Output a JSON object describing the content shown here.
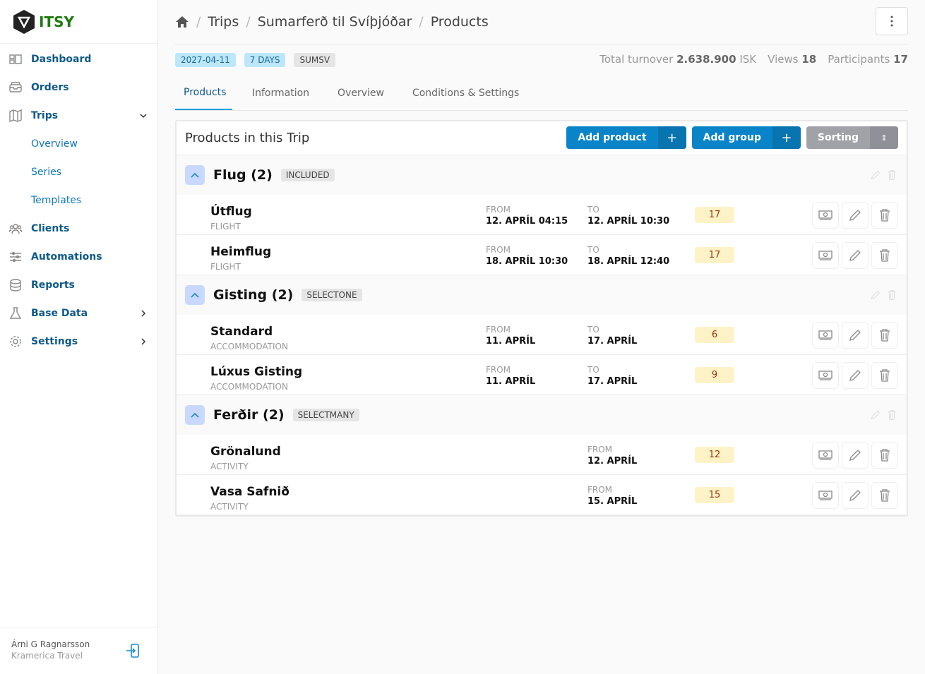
{
  "brand": {
    "name": "ITSY"
  },
  "sidebar": {
    "items": [
      {
        "label": "Dashboard",
        "icon": "dashboard-icon"
      },
      {
        "label": "Orders",
        "icon": "inbox-icon"
      },
      {
        "label": "Trips",
        "icon": "map-icon",
        "expanded": true
      },
      {
        "label": "Clients",
        "icon": "users-icon"
      },
      {
        "label": "Automations",
        "icon": "sliders-icon"
      },
      {
        "label": "Reports",
        "icon": "database-icon"
      },
      {
        "label": "Base Data",
        "icon": "flask-icon"
      },
      {
        "label": "Settings",
        "icon": "gear-icon"
      }
    ],
    "trips_sub": [
      "Overview",
      "Series",
      "Templates"
    ]
  },
  "user": {
    "name": "Árni G Ragnarsson",
    "company": "Kramerica Travel"
  },
  "breadcrumb": [
    "Trips",
    "Sumarferð til Svíþjóðar",
    "Products"
  ],
  "badges": {
    "date": "2027-04-11",
    "days": "7 DAYS",
    "code": "SUMSV"
  },
  "stats": {
    "turnover_label": "Total turnover",
    "turnover": "2.638.900",
    "currency": "ISK",
    "views_label": "Views",
    "views": "18",
    "participants_label": "Participants",
    "participants": "17"
  },
  "tabs": [
    "Products",
    "Information",
    "Overview",
    "Conditions & Settings"
  ],
  "card": {
    "title": "Products in this Trip",
    "add_product": "Add product",
    "add_group": "Add group",
    "sorting": "Sorting"
  },
  "groups": [
    {
      "name": "Flug (2)",
      "type": "INCLUDED",
      "products": [
        {
          "name": "Útflug",
          "type": "FLIGHT",
          "from": "12. APRÍL 04:15",
          "to": "12. APRÍL 10:30",
          "count": "17"
        },
        {
          "name": "Heimflug",
          "type": "FLIGHT",
          "from": "18. APRÍL 10:30",
          "to": "18. APRÍL 12:40",
          "count": "17"
        }
      ]
    },
    {
      "name": "Gisting (2)",
      "type": "SELECTONE",
      "products": [
        {
          "name": "Standard",
          "type": "ACCOMMODATION",
          "from": "11. APRÍL",
          "to": "17. APRÍL",
          "count": "6"
        },
        {
          "name": "Lúxus Gisting",
          "type": "ACCOMMODATION",
          "from": "11. APRÍL",
          "to": "17. APRÍL",
          "count": "9"
        }
      ]
    },
    {
      "name": "Ferðir (2)",
      "type": "SELECTMANY",
      "products": [
        {
          "name": "Grönalund",
          "type": "ACTIVITY",
          "from2": "12. APRÍL",
          "count": "12"
        },
        {
          "name": "Vasa Safnið",
          "type": "ACTIVITY",
          "from2": "15. APRÍL",
          "count": "15"
        }
      ]
    }
  ],
  "labels": {
    "from": "FROM",
    "to": "TO"
  }
}
